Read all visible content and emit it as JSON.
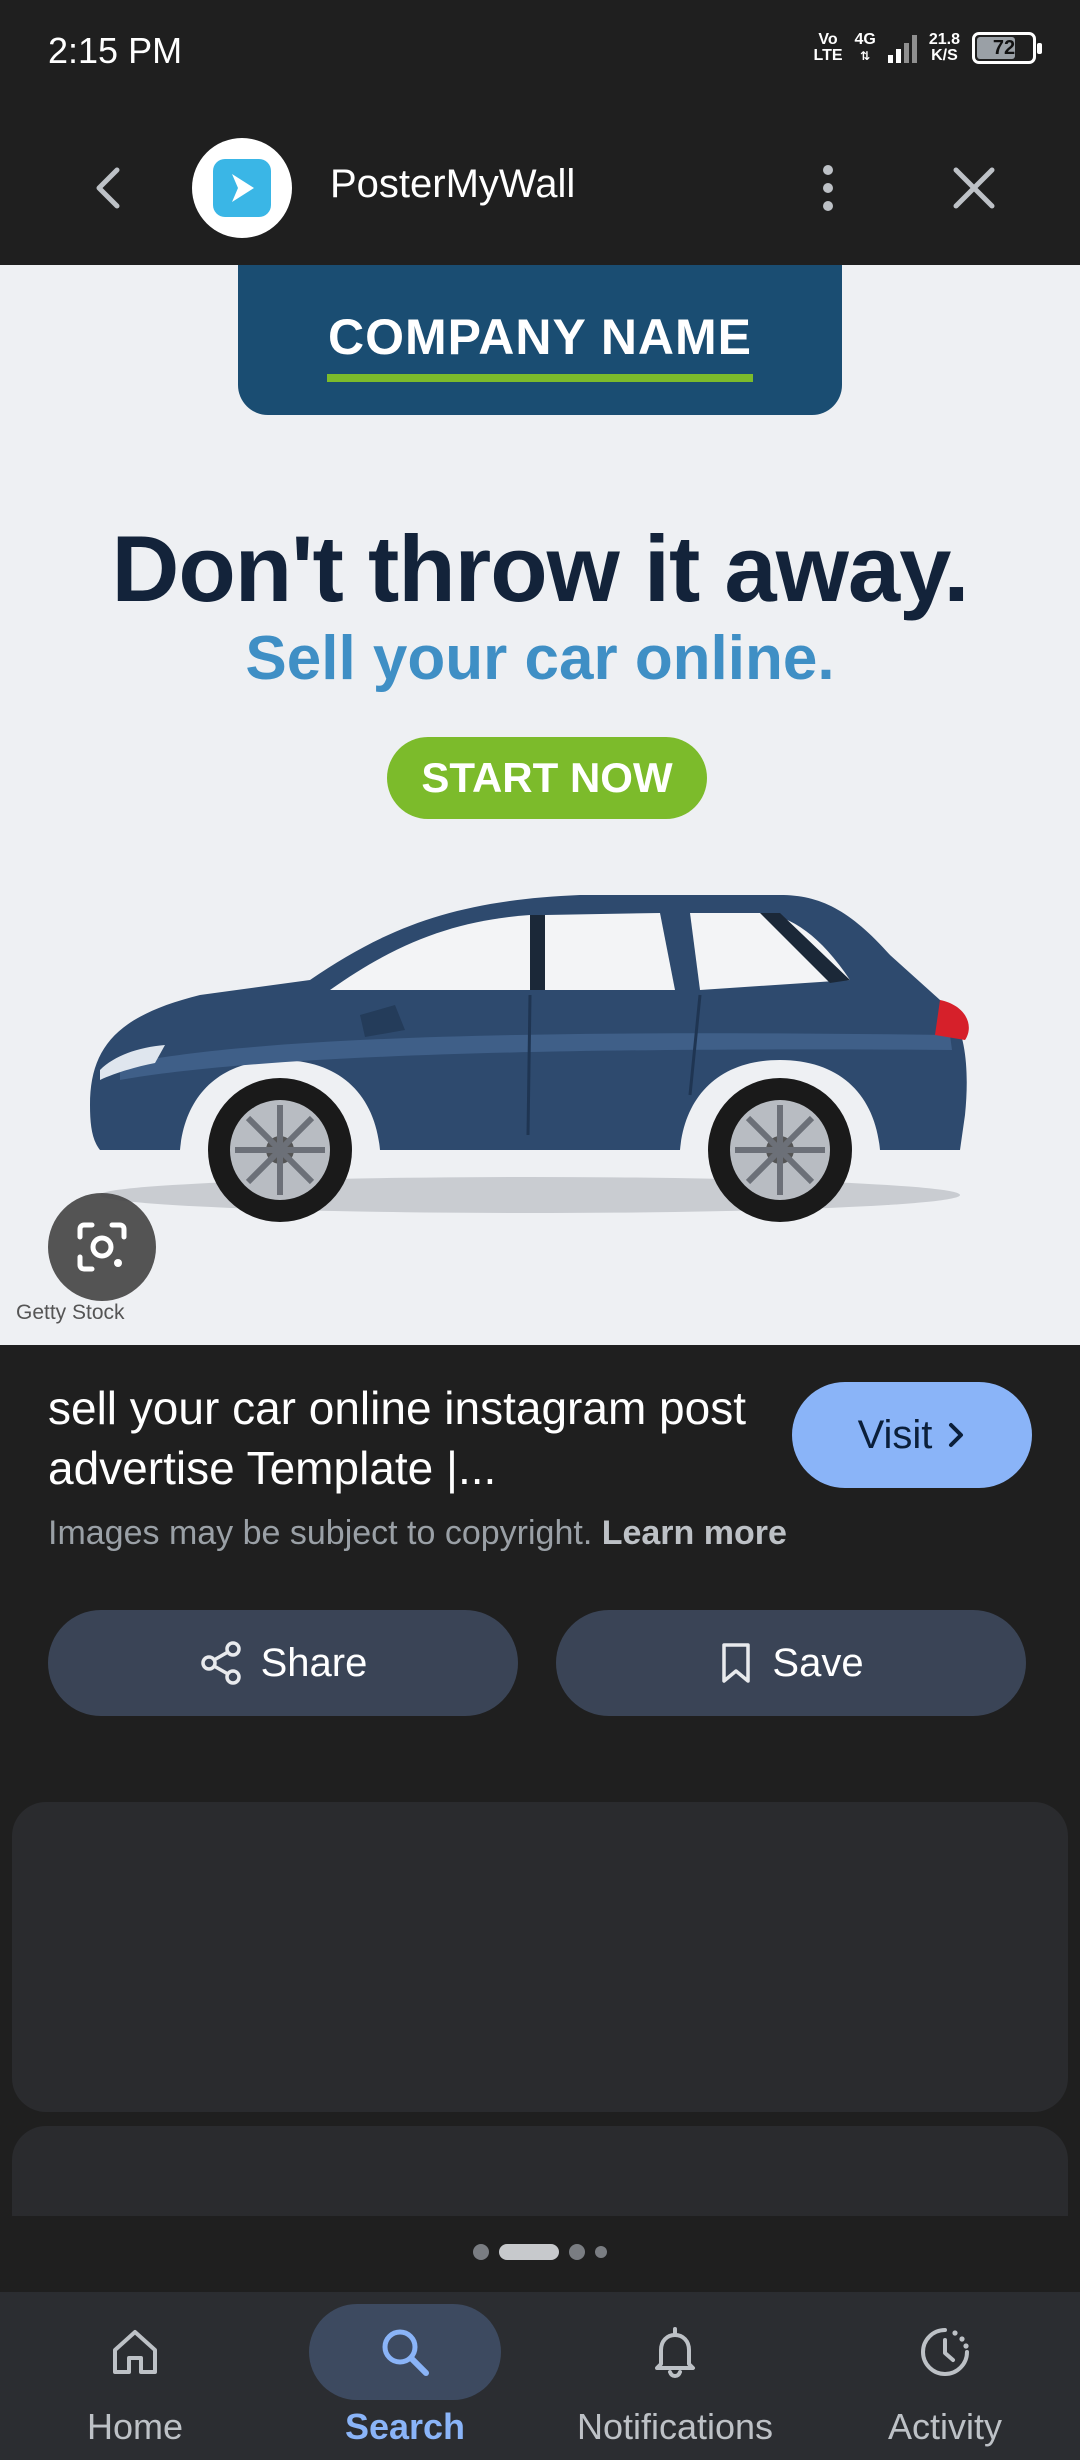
{
  "status_bar": {
    "time": "2:15 PM",
    "network_top": "Vo",
    "network_bottom": "LTE",
    "signal_type": "4G",
    "speed_value": "21.8",
    "speed_unit": "K/S",
    "battery": "72"
  },
  "header": {
    "site_name": "PosterMyWall",
    "back_icon": "chevron-left-icon",
    "more_icon": "more-vertical-icon",
    "close_icon": "close-icon"
  },
  "image": {
    "company_name": "COMPANY NAME",
    "headline": "Don't throw it away.",
    "subheadline": "Sell your car online.",
    "cta": "START NOW",
    "credit": "Getty Stock"
  },
  "result": {
    "title": "sell your car online instagram post advertise Template |...",
    "visit_label": "Visit",
    "copyright_text": "Images may be subject to copyright.",
    "learn_more": "Learn more"
  },
  "actions": {
    "share_label": "Share",
    "save_label": "Save"
  },
  "bottom_nav": {
    "items": [
      {
        "label": "Home",
        "icon": "home-icon"
      },
      {
        "label": "Search",
        "icon": "search-icon"
      },
      {
        "label": "Notifications",
        "icon": "bell-icon"
      },
      {
        "label": "Activity",
        "icon": "activity-icon"
      }
    ],
    "active": "Search"
  },
  "colors": {
    "accent": "#8ab4f8",
    "company_box": "#1a4d72",
    "cta_green": "#7cbb2b",
    "headline_navy": "#13233a",
    "subhead_blue": "#3f8fc5"
  }
}
